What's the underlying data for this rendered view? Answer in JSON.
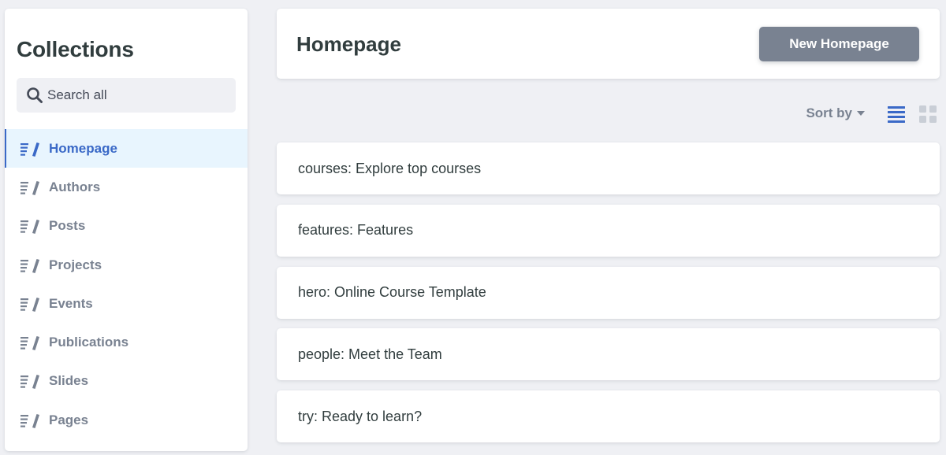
{
  "sidebar": {
    "title": "Collections",
    "search": {
      "placeholder": "Search all",
      "icon": "search-icon"
    },
    "items": [
      {
        "label": "Homepage",
        "active": true,
        "icon": "collection-icon"
      },
      {
        "label": "Authors",
        "active": false,
        "icon": "collection-icon"
      },
      {
        "label": "Posts",
        "active": false,
        "icon": "collection-icon"
      },
      {
        "label": "Projects",
        "active": false,
        "icon": "collection-icon"
      },
      {
        "label": "Events",
        "active": false,
        "icon": "collection-icon"
      },
      {
        "label": "Publications",
        "active": false,
        "icon": "collection-icon"
      },
      {
        "label": "Slides",
        "active": false,
        "icon": "collection-icon"
      },
      {
        "label": "Pages",
        "active": false,
        "icon": "collection-icon"
      }
    ]
  },
  "header": {
    "title": "Homepage",
    "new_button_label": "New Homepage"
  },
  "toolbar": {
    "sort_label": "Sort by",
    "view_mode": "list"
  },
  "entries": [
    "courses: Explore top courses",
    "features: Features",
    "hero: Online Course Template",
    "people: Meet the Team",
    "try: Ready to learn?"
  ],
  "colors": {
    "accent": "#3a69c7",
    "background": "#eff0f4",
    "active_bg": "#e8f5fe",
    "muted": "#798291",
    "text": "#313d3e",
    "button": "#798291"
  }
}
